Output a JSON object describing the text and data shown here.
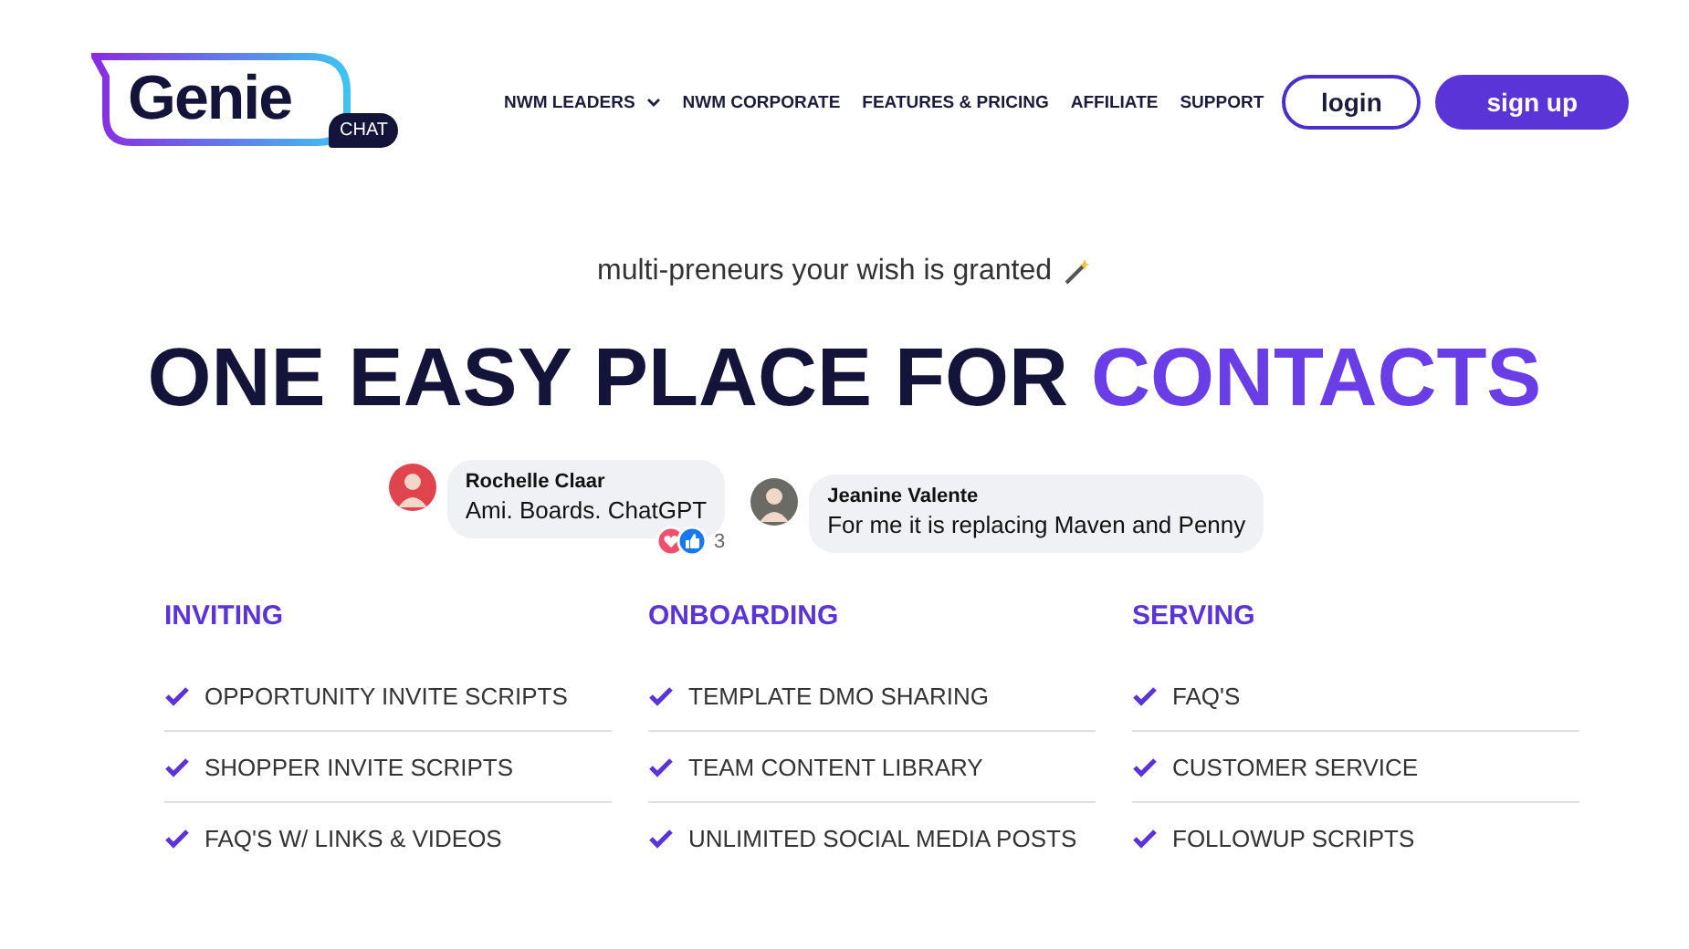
{
  "logo": {
    "word": "Genie",
    "badge": "CHAT"
  },
  "nav": [
    {
      "label": "NWM LEADERS",
      "dropdown": true
    },
    {
      "label": "NWM CORPORATE",
      "dropdown": false
    },
    {
      "label": "FEATURES & PRICING",
      "dropdown": false
    },
    {
      "label": "AFFILIATE",
      "dropdown": false
    },
    {
      "label": "SUPPORT",
      "dropdown": false
    }
  ],
  "buttons": [
    {
      "label": "login",
      "kind": "outline"
    },
    {
      "label": "sign up",
      "kind": "filled"
    }
  ],
  "tagline": "multi-preneurs your wish is granted",
  "headline": {
    "text": "ONE EASY PLACE FOR",
    "highlight": "CONTACTS"
  },
  "comments": [
    {
      "author": "Rochelle Claar",
      "text": "Ami. Boards. ChatGPT",
      "reactions": "3",
      "color": "#e0444f"
    },
    {
      "author": "Jeanine Valente",
      "text": "For me it is replacing Maven and Penny",
      "color": "#6b6b66"
    }
  ],
  "columns": [
    {
      "title": "INVITING",
      "items": [
        "OPPORTUNITY INVITE SCRIPTS",
        "SHOPPER INVITE SCRIPTS",
        "FAQ'S W/ LINKS & VIDEOS"
      ]
    },
    {
      "title": "ONBOARDING",
      "items": [
        "TEMPLATE DMO SHARING",
        "TEAM CONTENT LIBRARY",
        "UNLIMITED SOCIAL MEDIA POSTS"
      ]
    },
    {
      "title": "SERVING",
      "items": [
        "FAQ'S",
        "CUSTOMER SERVICE",
        "FOLLOWUP SCRIPTS"
      ]
    }
  ]
}
